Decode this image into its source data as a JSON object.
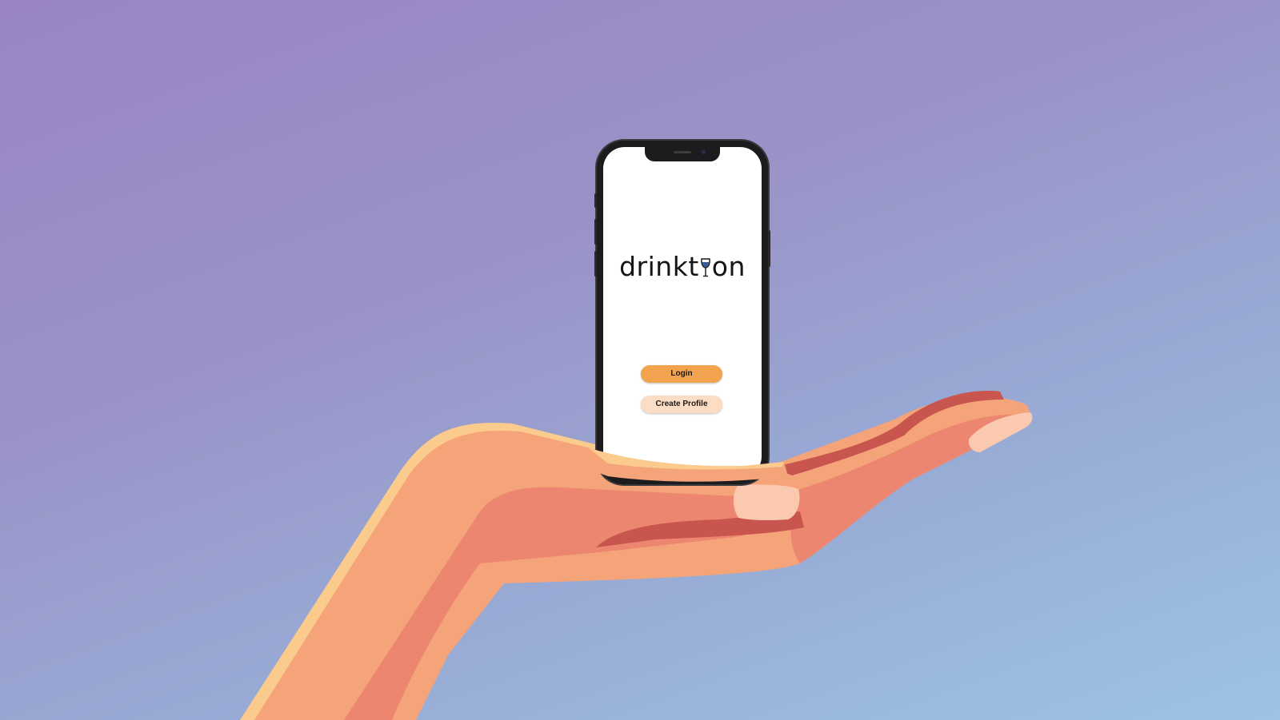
{
  "app": {
    "logo_prefix": "drinkt",
    "logo_suffix": "on",
    "logo_glyph": "wine-glass-icon"
  },
  "buttons": {
    "login_label": "Login",
    "create_profile_label": "Create Profile"
  },
  "colors": {
    "background_top": "#9a84c4",
    "background_bottom": "#9cc3e4",
    "login_button": "#f3a24e",
    "create_profile_button": "#fcdcc2",
    "wine": "#3a5aa0",
    "hand_skin": "#f5a47a",
    "hand_shadow": "#ec8670",
    "hand_highlight": "#fbcb8d"
  }
}
